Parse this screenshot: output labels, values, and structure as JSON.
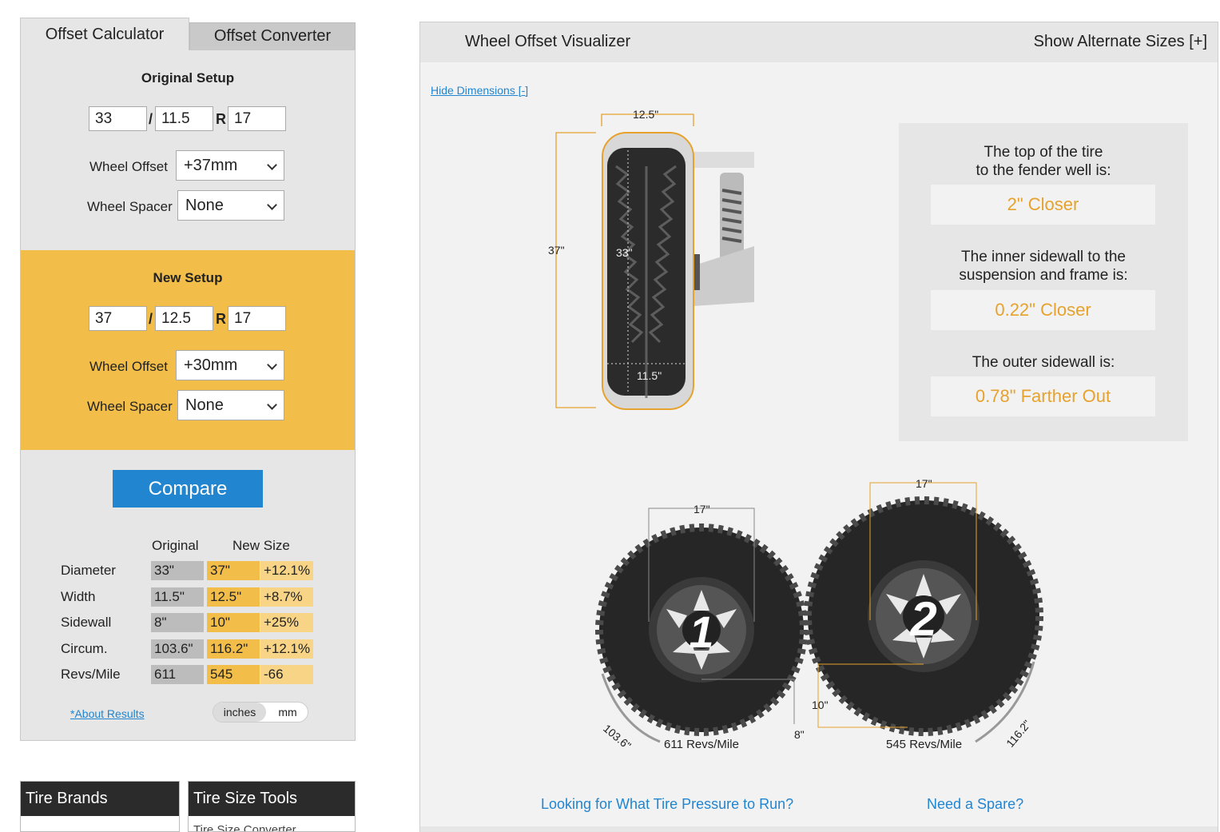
{
  "tabs": {
    "calculator": "Offset Calculator",
    "converter": "Offset Converter"
  },
  "original": {
    "title": "Original Setup",
    "height": "33",
    "width": "11.5",
    "rim": "17",
    "slash": "/",
    "r_label": "R",
    "offset_label": "Wheel Offset",
    "offset_value": "+37mm",
    "spacer_label": "Wheel Spacer",
    "spacer_value": "None"
  },
  "new_setup": {
    "title": "New Setup",
    "height": "37",
    "width": "12.5",
    "rim": "17",
    "slash": "/",
    "r_label": "R",
    "offset_label": "Wheel Offset",
    "offset_value": "+30mm",
    "spacer_label": "Wheel Spacer",
    "spacer_value": "None"
  },
  "compare_label": "Compare",
  "results": {
    "col_original": "Original",
    "col_new": "New Size",
    "rows": [
      {
        "label": "Diameter",
        "original": "33\"",
        "new": "37\"",
        "change": "+12.1%"
      },
      {
        "label": "Width",
        "original": "11.5\"",
        "new": "12.5\"",
        "change": "+8.7%"
      },
      {
        "label": "Sidewall",
        "original": "8\"",
        "new": "10\"",
        "change": "+25%"
      },
      {
        "label": "Circum.",
        "original": "103.6\"",
        "new": "116.2\"",
        "change": "+12.1%"
      },
      {
        "label": "Revs/Mile",
        "original": "611",
        "new": "545",
        "change": "-66"
      }
    ],
    "about_link": "*About Results",
    "unit_inches": "inches",
    "unit_mm": "mm"
  },
  "bottom": {
    "tire_brands": "Tire Brands",
    "tire_size_tools": "Tire Size Tools",
    "tire_size_tools_first": "Tire Size Converter"
  },
  "visualizer": {
    "title": "Wheel Offset Visualizer",
    "alt_sizes": "Show Alternate Sizes [+]",
    "hide_dims": "Hide Dimensions [-]",
    "side_view": {
      "new_width": "12.5\"",
      "new_height": "37\"",
      "orig_height": "33\"",
      "orig_width": "11.5\""
    },
    "info": {
      "top_label": "The top of the tire\nto the fender well is:",
      "top_line1": "The top of the tire",
      "top_line2": "to the fender well is:",
      "top_value": "2\" Closer",
      "inner_line1": "The inner sidewall to the",
      "inner_line2": "suspension and frame is:",
      "inner_value": "0.22\" Closer",
      "outer_line1": "The outer sidewall is:",
      "outer_value": "0.78\" Farther Out"
    },
    "tire1": {
      "badge": "1",
      "rim": "17\"",
      "sidewall": "8\"",
      "circum": "103.6\"",
      "revs": "611 Revs/Mile"
    },
    "tire2": {
      "badge": "2",
      "rim": "17\"",
      "sidewall": "10\"",
      "circum": "116.2\"",
      "revs": "545 Revs/Mile"
    },
    "link_pressure": "Looking for What Tire Pressure to Run?",
    "link_spare": "Need a Spare?"
  },
  "colors": {
    "accent_orange": "#f2bd48",
    "value_orange": "#e6a22c",
    "link_blue": "#2185d0",
    "button_blue": "#2185d0"
  }
}
